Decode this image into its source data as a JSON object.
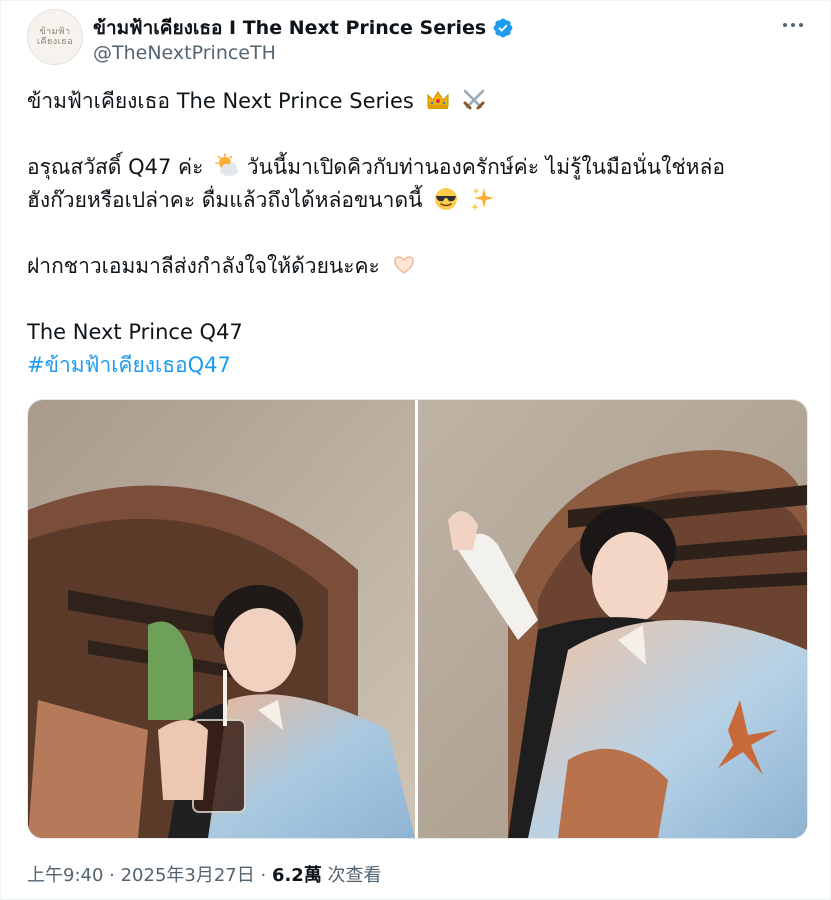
{
  "author": {
    "display_name": "ข้ามฟ้าเคียงเธอ I The Next Prince Series",
    "handle": "@TheNextPrinceTH",
    "avatar_text_line1": "ข้ามฟ้า",
    "avatar_text_line2": "เคียงเธอ",
    "verified": true
  },
  "tweet": {
    "line1": "ข้ามฟ้าเคียงเธอ The Next Prince Series",
    "line1_emojis": [
      "crown-icon",
      "crossed-swords-icon"
    ],
    "line2": "อรุณสวัสดิ์ Q47 ค่ะ",
    "line2_emoji": "sun-behind-cloud-icon",
    "line2_cont": "วันนี้มาเปิดคิวกับท่านองครักษ์ค่ะ ไม่รู้ในมือนั่นใช่หล่อ",
    "line3": "ฮังก๊วยหรือเปล่าคะ ดื่มแล้วถึงได้หล่อขนาดนี้",
    "line3_emojis": [
      "sunglasses-face-icon",
      "sparkles-icon"
    ],
    "line4": "ฝากชาวเอมมาลีส่งกำลังใจให้ด้วยนะคะ",
    "line4_emoji": "heart-hands-icon",
    "line5": "The Next Prince Q47",
    "hashtag": "#ข้ามฟ้าเคียงเธอQ47"
  },
  "media": {
    "photos": [
      "photo-left",
      "photo-right"
    ]
  },
  "meta": {
    "time": "上午9:40",
    "sep1": " · ",
    "date": "2025年3月27日",
    "sep2": " · ",
    "views_count": "6.2萬",
    "views_label": " 次查看"
  },
  "colors": {
    "link": "#1d9bf0",
    "text": "#0f1419",
    "muted": "#536471",
    "verified": "#1d9bf0"
  }
}
